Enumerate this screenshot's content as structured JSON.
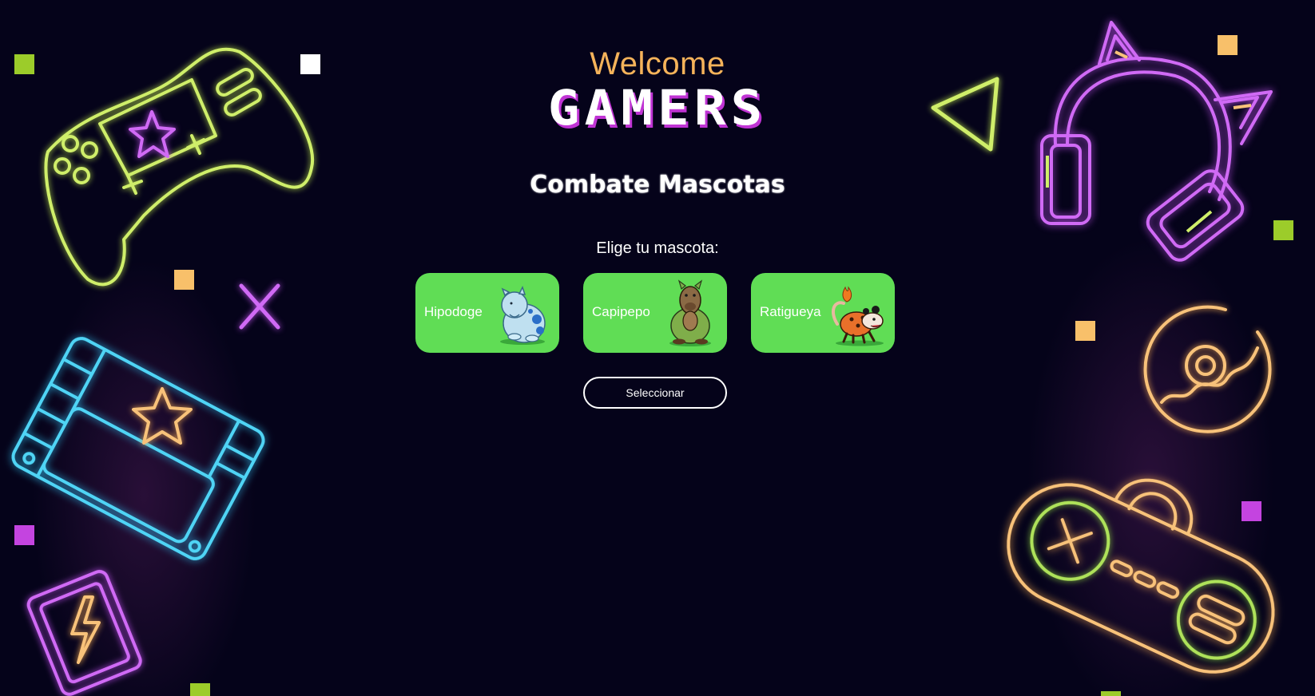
{
  "header": {
    "welcome": "Welcome",
    "gamers": "GAMERS"
  },
  "main": {
    "title": "Combate Mascotas",
    "choose_label": "Elige tu mascota:",
    "pets": [
      {
        "name": "Hipodoge",
        "icon": "hipodoge-pet-image"
      },
      {
        "name": "Capipepo",
        "icon": "capipepo-pet-image"
      },
      {
        "name": "Ratigueya",
        "icon": "ratigueya-pet-image"
      }
    ],
    "select_button": "Seleccionar"
  },
  "colors": {
    "background": "#05031a",
    "welcome": "#f5b35a",
    "card": "#60dd55",
    "neon_lime": "#cfee6a",
    "neon_purple": "#d06af5",
    "neon_cyan": "#4fd4f5",
    "neon_orange": "#f8c27a"
  },
  "decorations": [
    "gamepad-neon-icon",
    "cartridge-neon-icon",
    "lightning-card-neon-icon",
    "x-mark-neon-icon",
    "triangle-neon-icon",
    "cat-headphones-neon-icon",
    "disc-neon-icon",
    "retro-controller-neon-icon"
  ]
}
